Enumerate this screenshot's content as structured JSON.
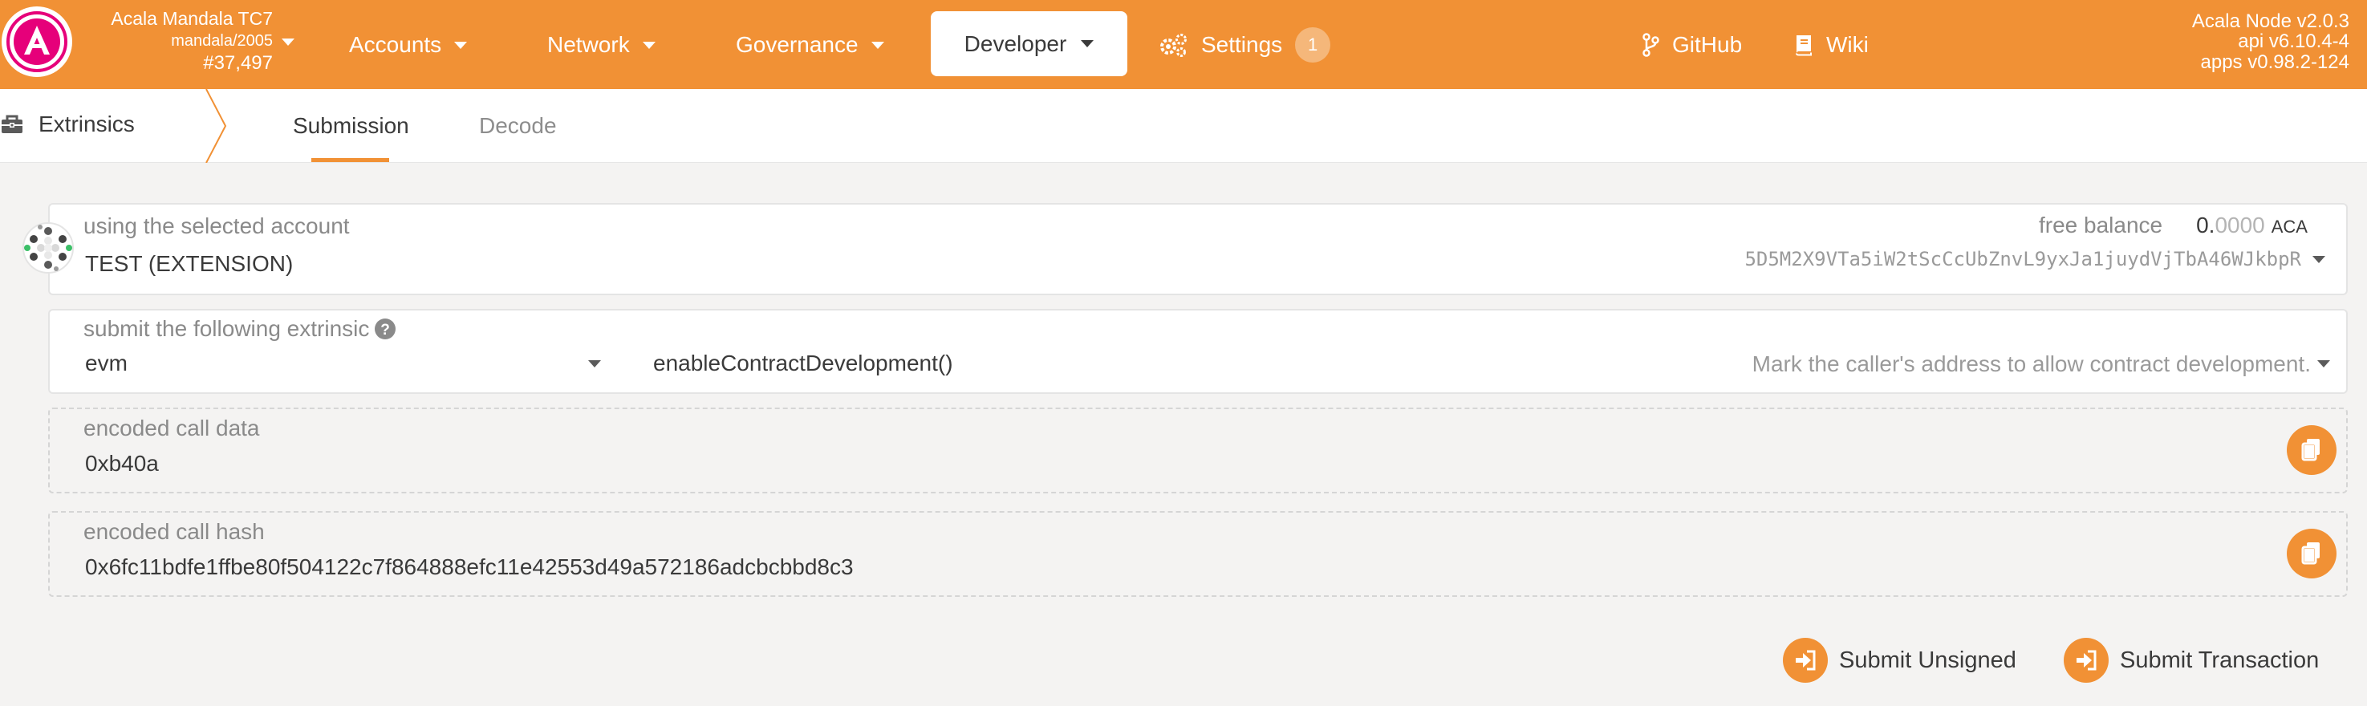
{
  "header": {
    "chain_name": "Acala Mandala TC7",
    "chain_spec": "mandala/2005",
    "best_block": "#37,497",
    "nav": {
      "accounts": "Accounts",
      "network": "Network",
      "governance": "Governance",
      "developer": "Developer",
      "settings": "Settings",
      "settings_badge": "1",
      "github": "GitHub",
      "wiki": "Wiki"
    },
    "version": {
      "node": "Acala Node v2.0.3",
      "api": "api v6.10.4-4",
      "apps": "apps v0.98.2-124"
    }
  },
  "subnav": {
    "section": "Extrinsics",
    "tabs": [
      {
        "label": "Submission",
        "active": true
      },
      {
        "label": "Decode",
        "active": false
      }
    ]
  },
  "account": {
    "label": "using the selected account",
    "name": "TEST (EXTENSION)",
    "balance_label": "free balance",
    "balance_int": "0.",
    "balance_frac": "0000",
    "balance_unit": "ACA",
    "address": "5D5M2X9VTa5iW2tScCcUbZnvL9yxJa1juydVjTbA46WJkbpR"
  },
  "extrinsic": {
    "label": "submit the following extrinsic",
    "module": "evm",
    "method": "enableContractDevelopment()",
    "description": "Mark the caller's address to allow contract development."
  },
  "call_data": {
    "label": "encoded call data",
    "value": "0xb40a"
  },
  "call_hash": {
    "label": "encoded call hash",
    "value": "0x6fc11bdfe1ffbe80f504122c7f864888efc11e42553d49a572186adcbcbbd8c3"
  },
  "actions": {
    "submit_unsigned": "Submit Unsigned",
    "submit_transaction": "Submit Transaction"
  },
  "colors": {
    "accent": "#f19135",
    "logo": "#e6007a"
  }
}
